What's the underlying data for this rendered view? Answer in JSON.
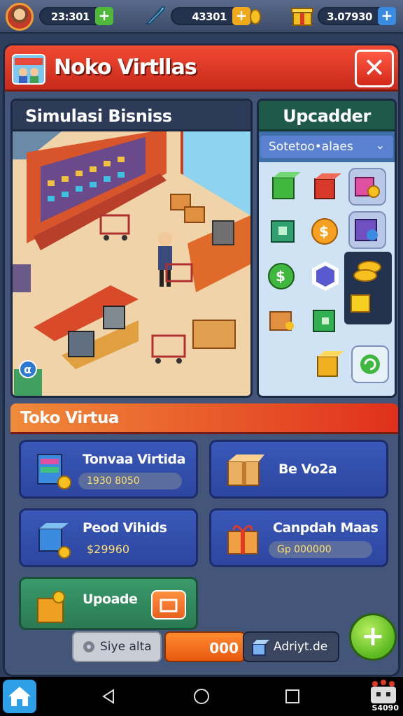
{
  "topbar": {
    "resource_1": {
      "value": "23:301",
      "plus": "+",
      "plus_color": "#4fb83a"
    },
    "resource_2": {
      "value": "43301",
      "plus": "+",
      "plus_color": "#f0a81c"
    },
    "resource_3": {
      "value": "3.07930",
      "plus": "+",
      "plus_color": "#3a8ae0"
    }
  },
  "header": {
    "title": "Noko Virtllas",
    "close": "✕"
  },
  "scene": {
    "title": "Simulasi Bisniss",
    "badge": "α"
  },
  "upgrades": {
    "title": "Upcadder",
    "dropdown_label": "Sotetoo•alaes",
    "dropdown_caret": "⌄"
  },
  "section": {
    "title": "Toko Virtua"
  },
  "cards": [
    {
      "name": "Tonvaa Virtida",
      "price": "1930 8050"
    },
    {
      "name": "Be Vo2a",
      "price": ""
    },
    {
      "name": "Peod Vihids",
      "price": "$29960"
    },
    {
      "name": "Canpdah Maas",
      "price": "Gp 000000"
    },
    {
      "name": "Upoade",
      "price": ""
    }
  ],
  "bottom": {
    "stats_label": "Siye alta",
    "counter_value": "000",
    "add_label": "Adriyt.de",
    "fab": "+"
  },
  "sysnav": {
    "badge_text": "S4090"
  },
  "colors": {
    "header_red": "#e03a26",
    "section_orange": "#f08a3a",
    "card_blue": "#3a58b8",
    "card_green": "#2a7a52",
    "panel_bg": "#44557a"
  }
}
